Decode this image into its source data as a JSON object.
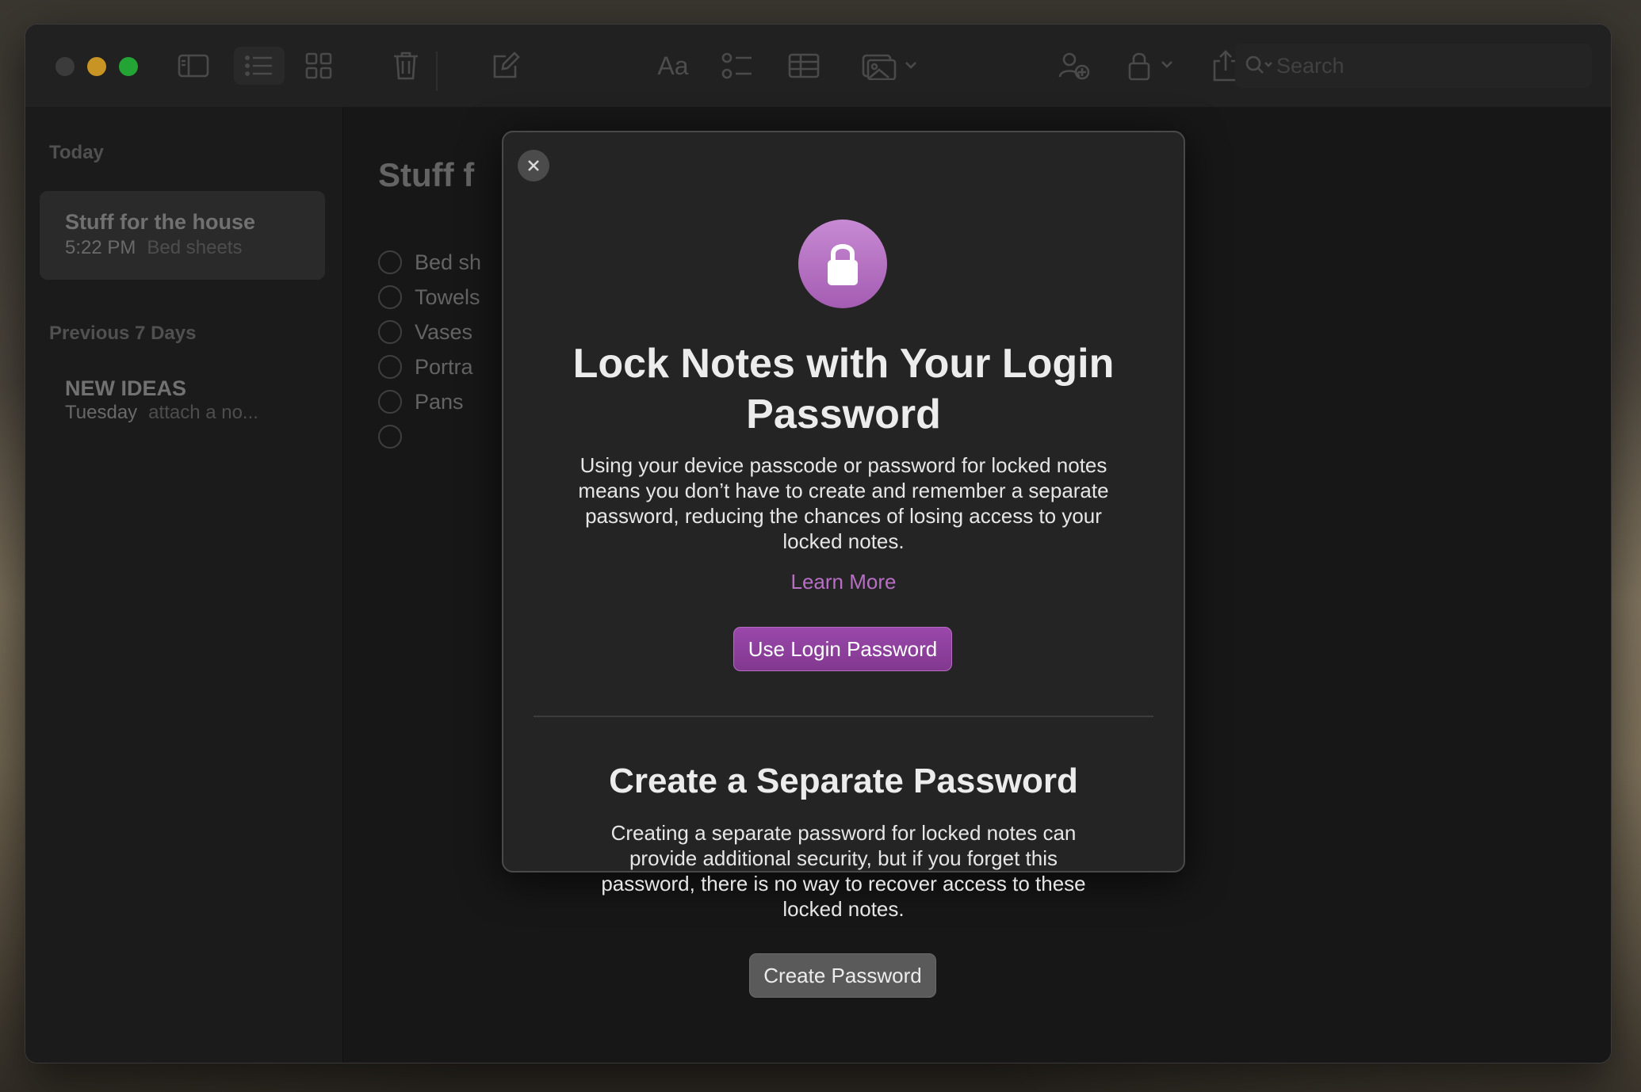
{
  "sidebar": {
    "sections": [
      {
        "heading": "Today",
        "notes": [
          {
            "title": "Stuff for the house",
            "time": "5:22 PM",
            "preview": "Bed sheets",
            "selected": true
          }
        ]
      },
      {
        "heading": "Previous 7 Days",
        "notes": [
          {
            "title": "NEW IDEAS",
            "time": "Tuesday",
            "preview": "attach a no...",
            "selected": false
          }
        ]
      }
    ]
  },
  "toolbar": {
    "format_label": "Aa",
    "search": {
      "placeholder": "Search"
    },
    "icons": [
      "sidebar-toggle-icon",
      "list-view-icon",
      "gallery-view-icon",
      "trash-icon",
      "compose-icon",
      "format-icon",
      "checklist-icon",
      "table-icon",
      "media-icon",
      "collaborate-icon",
      "lock-icon",
      "share-icon",
      "search-icon"
    ]
  },
  "editor": {
    "title": "Stuff f",
    "checklist": [
      "Bed sh",
      "Towels",
      "Vases",
      "Portra",
      "Pans",
      ""
    ]
  },
  "dialog": {
    "title": "Lock Notes with Your Login Password",
    "body": "Using your device passcode or password for locked notes means you don’t have to create and remember a separate password, reducing the chances of losing access to your locked notes.",
    "learn_more": "Learn More",
    "primary_button": "Use Login Password",
    "section2_title": "Create a Separate Password",
    "section2_body": "Creating a separate password for locked notes can provide additional security, but if you forget this password, there is no way to recover access to these locked notes.",
    "secondary_button": "Create Password"
  },
  "colors": {
    "accent": "#9a48ab",
    "link": "#b76fc5",
    "lock_badge": "#b46fc2",
    "close_traffic": "#4a4949",
    "minimize_traffic": "#f5b62d",
    "maximize_traffic": "#2bc840"
  }
}
